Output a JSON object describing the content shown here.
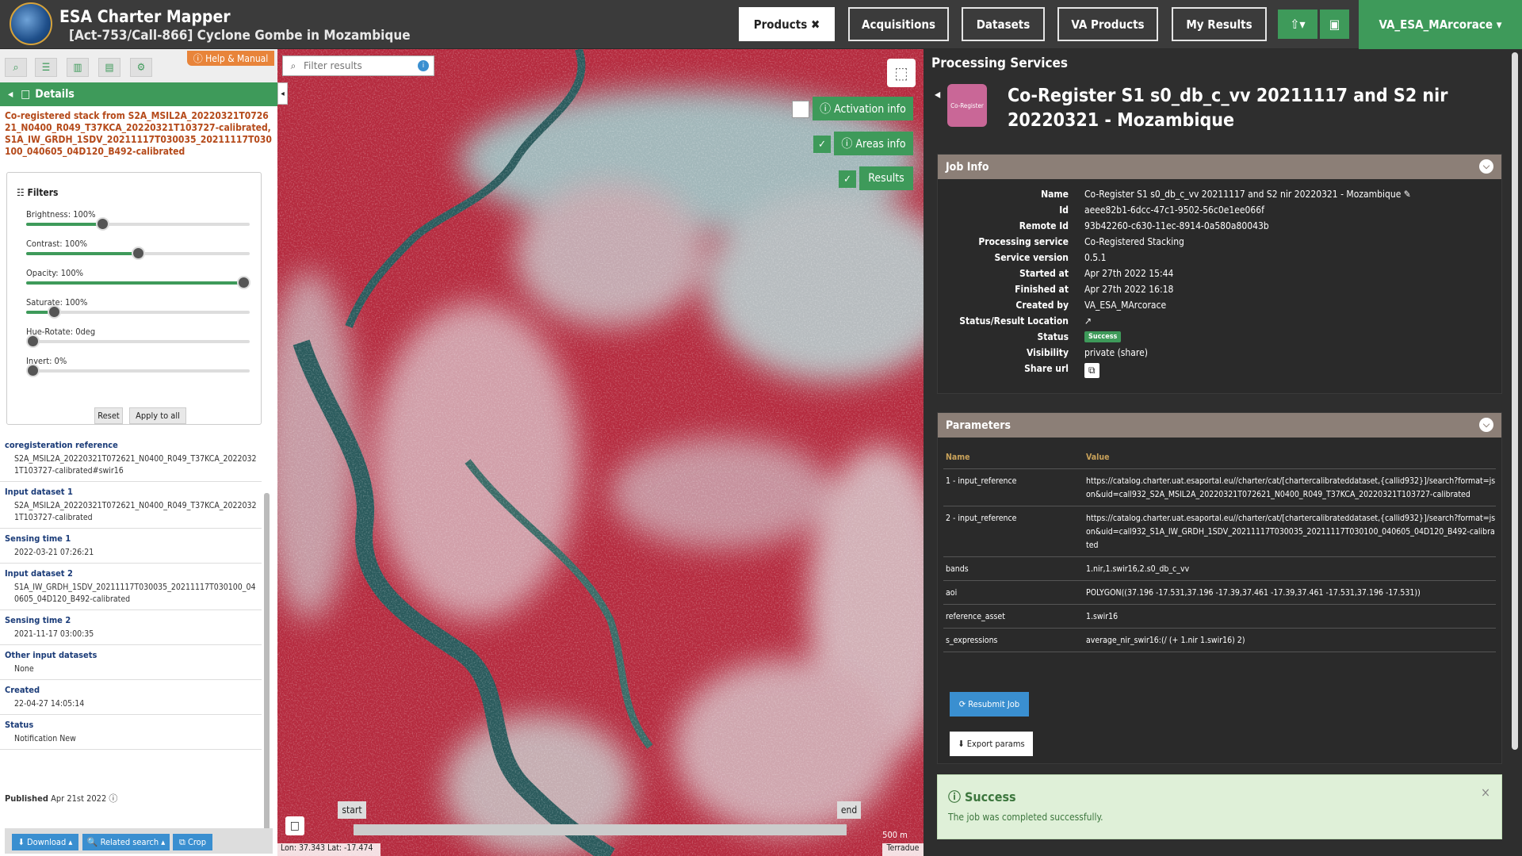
{
  "header": {
    "app_title": "ESA Charter Mapper",
    "activation_title": "[Act-753/Call-866] Cyclone Gombe in Mozambique",
    "nav": [
      {
        "label": "Products ✖"
      },
      {
        "label": "Acquisitions"
      },
      {
        "label": "Datasets"
      },
      {
        "label": "VA Products"
      },
      {
        "label": "My Results"
      }
    ],
    "upload_icon": "upload-icon",
    "briefcase_icon": "briefcase-icon",
    "user": "VA_ESA_MArcorace ▾"
  },
  "left_panel": {
    "help_label": "ⓘ Help & Manual",
    "details_label": "Details",
    "product_title": "Co-registered stack from S2A_MSIL2A_20220321T072621_N0400_R049_T37KCA_20220321T103727-calibrated, S1A_IW_GRDH_1SDV_20211117T030035_20211117T030100_040605_04D120_B492-calibrated",
    "filters_title": "Filters",
    "sliders": [
      {
        "label": "Brightness: 100%",
        "value": 0.33
      },
      {
        "label": "Contrast: 100%",
        "value": 0.5
      },
      {
        "label": "Opacity: 100%",
        "value": 1.0
      },
      {
        "label": "Saturate: 100%",
        "value": 0.1
      },
      {
        "label": "Hue-Rotate: 0deg",
        "value": 0.0
      },
      {
        "label": "Invert: 0%",
        "value": 0.0
      }
    ],
    "reset_label": "Reset",
    "apply_label": "Apply to all",
    "properties": [
      {
        "key": "coregisteration reference",
        "value": "S2A_MSIL2A_20220321T072621_N0400_R049_T37KCA_20220321T103727-calibrated#swir16"
      },
      {
        "key": "Input dataset 1",
        "value": "S2A_MSIL2A_20220321T072621_N0400_R049_T37KCA_20220321T103727-calibrated"
      },
      {
        "key": "Sensing time 1",
        "value": "2022-03-21 07:26:21"
      },
      {
        "key": "Input dataset 2",
        "value": "S1A_IW_GRDH_1SDV_20211117T030035_20211117T030100_040605_04D120_B492-calibrated"
      },
      {
        "key": "Sensing time 2",
        "value": "2021-11-17 03:00:35"
      },
      {
        "key": "Other input datasets",
        "value": "None"
      },
      {
        "key": "Created",
        "value": "22-04-27 14:05:14"
      },
      {
        "key": "Status",
        "value": "Notification New"
      }
    ],
    "published_label": "Published",
    "published_date": "Apr 21st 2022 ⓘ",
    "download_label": "⬇ Download ▴",
    "related_label": "🔍 Related search ▴",
    "crop_label": "⧉ Crop"
  },
  "map": {
    "filter_placeholder": "Filter results",
    "activation_info": "ⓘ Activation info",
    "areas_info": "ⓘ Areas info",
    "results": "Results",
    "time_start": "start",
    "time_end": "end",
    "scale": "500 m",
    "coords": "Lon: 37.343 Lat: -17.474",
    "attribution": "Terradue"
  },
  "right_panel": {
    "panel_title": "Processing Services",
    "job_icon_text": "Co-Register",
    "job_title": "Co-Register S1 s0_db_c_vv 20211117 and S2 nir 20220321 - Mozambique",
    "job_info_title": "Job Info",
    "job_info": [
      {
        "key": "Name",
        "value": "Co-Register S1 s0_db_c_vv 20211117 and S2 nir 20220321 - Mozambique ✎"
      },
      {
        "key": "Id",
        "value": "aeee82b1-6dcc-47c1-9502-56c0e1ee066f"
      },
      {
        "key": "Remote Id",
        "value": "93b42260-c630-11ec-8914-0a580a80043b"
      },
      {
        "key": "Processing service",
        "value": "Co-Registered Stacking"
      },
      {
        "key": "Service version",
        "value": "0.5.1"
      },
      {
        "key": "Started at",
        "value": "Apr 27th 2022 15:44"
      },
      {
        "key": "Finished at",
        "value": "Apr 27th 2022 16:18"
      },
      {
        "key": "Created by",
        "value": "VA_ESA_MArcorace"
      },
      {
        "key": "Status/Result Location",
        "value": "↗"
      },
      {
        "key": "Status",
        "value": "Success"
      },
      {
        "key": "Visibility",
        "value": "private (share)"
      },
      {
        "key": "Share url",
        "value": "⧉"
      }
    ],
    "params_title": "Parameters",
    "params_header": {
      "name": "Name",
      "value": "Value"
    },
    "params": [
      {
        "name": "1 - input_reference",
        "value": "https://catalog.charter.uat.esaportal.eu//charter/cat/[chartercalibrateddataset,{callid932}]/search?format=json&uid=call932_S2A_MSIL2A_20220321T072621_N0400_R049_T37KCA_20220321T103727-calibrated"
      },
      {
        "name": "2 - input_reference",
        "value": "https://catalog.charter.uat.esaportal.eu//charter/cat/[chartercalibrateddataset,{callid932}]/search?format=json&uid=call932_S1A_IW_GRDH_1SDV_20211117T030035_20211117T030100_040605_04D120_B492-calibrated"
      },
      {
        "name": "bands",
        "value": "1.nir,1.swir16,2.s0_db_c_vv"
      },
      {
        "name": "aoi",
        "value": "POLYGON((37.196 -17.531,37.196 -17.39,37.461 -17.39,37.461 -17.531,37.196 -17.531))"
      },
      {
        "name": "reference_asset",
        "value": "1.swir16"
      },
      {
        "name": "s_expressions",
        "value": "average_nir_swir16:(/ (+ 1.nir 1.swir16) 2)"
      }
    ],
    "resubmit_label": "⟳ Resubmit Job",
    "export_label": "⬇ Export params",
    "success_title": "ⓘ Success",
    "success_msg": "The job was completed successfully.",
    "close_icon": "×"
  }
}
